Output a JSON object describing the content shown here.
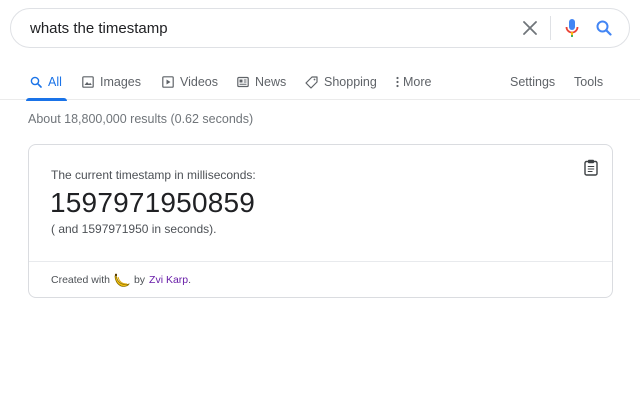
{
  "search": {
    "query": "whats the timestamp"
  },
  "tabs": [
    {
      "label": "All",
      "icon": "search-icon",
      "active": true
    },
    {
      "label": "Images",
      "icon": "image-icon"
    },
    {
      "label": "Videos",
      "icon": "play-icon"
    },
    {
      "label": "News",
      "icon": "news-icon"
    },
    {
      "label": "Shopping",
      "icon": "tag-icon"
    },
    {
      "label": "More",
      "icon": "more-vert-icon"
    }
  ],
  "toolbar": {
    "settings": "Settings",
    "tools": "Tools"
  },
  "stats": "About 18,800,000 results (0.62 seconds)",
  "card": {
    "label": "The current timestamp in milliseconds:",
    "ms": "1597971950859",
    "seconds": "( and 1597971950 in seconds).",
    "footer_prefix": "Created with",
    "footer_by": "by",
    "author": "Zvi Karp",
    "footer_suffix": "."
  },
  "colors": {
    "accent": "#1a73e8",
    "link_visited": "#681da8"
  }
}
